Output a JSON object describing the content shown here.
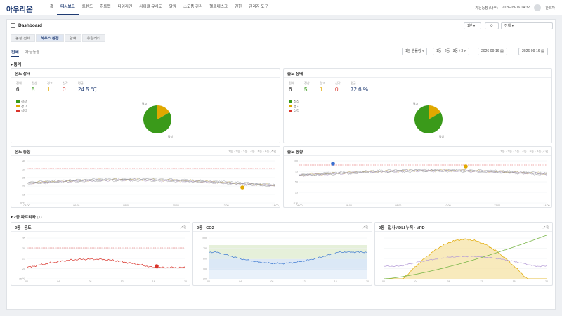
{
  "app": {
    "logo": "아우리온",
    "logo_sub": "| ·"
  },
  "nav": [
    "홈",
    "대시보드",
    "트렌드",
    "히트맵",
    "타임라인",
    "사이클 유사도",
    "알람",
    "소모품 관리",
    "헬프데스크",
    "권한",
    "관리자 도구"
  ],
  "nav_active": 1,
  "top_right": {
    "farm": "가능농장 (나주)",
    "datetime": "2026-09-16 14:32",
    "user": "관리자"
  },
  "dashboard": {
    "title": "Dashboard",
    "interval": "1분",
    "refresh_icon": "refresh-icon",
    "scope": "전체"
  },
  "subtabs": [
    "농장 전체",
    "하우스 환경",
    "양액",
    "유틸리티"
  ],
  "subtab_active": 1,
  "viewtabs": [
    "전체",
    "가능농장"
  ],
  "filters": {
    "sampling": "1분 샘플링",
    "houses": "1동 · 2동 · 3동 +3",
    "start": "2026-09-16",
    "end": "2026-09-16"
  },
  "stats_section": {
    "title": "▾ 통계"
  },
  "temp_status": {
    "title": "온도 상태",
    "kpis": [
      {
        "label": "전체",
        "value": "6",
        "color": "#222222"
      },
      {
        "label": "정상",
        "value": "5",
        "color": "#3a9a1a"
      },
      {
        "label": "경고",
        "value": "1",
        "color": "#e0a800"
      },
      {
        "label": "심각",
        "value": "0",
        "color": "#d9342b"
      }
    ],
    "avg": {
      "label": "평균",
      "value": "24.5 ℃",
      "color": "#1f3b73"
    },
    "pie_labels": {
      "warn": "경고",
      "normal": "정상"
    },
    "pie": {
      "normal": 5,
      "warn": 1,
      "crit": 0
    }
  },
  "hum_status": {
    "title": "습도 상태",
    "kpis": [
      {
        "label": "전체",
        "value": "6",
        "color": "#222222"
      },
      {
        "label": "정상",
        "value": "5",
        "color": "#3a9a1a"
      },
      {
        "label": "경고",
        "value": "1",
        "color": "#e0a800"
      },
      {
        "label": "심각",
        "value": "0",
        "color": "#d9342b"
      }
    ],
    "avg": {
      "label": "평균",
      "value": "72.6 %",
      "color": "#1f3b73"
    },
    "pie_labels": {
      "warn": "경고",
      "normal": "정상"
    },
    "pie": {
      "normal": 5,
      "warn": 1,
      "crit": 0
    }
  },
  "legend": [
    {
      "label": "정상",
      "color": "#3a9a1a"
    },
    {
      "label": "경고",
      "color": "#e0a800"
    },
    {
      "label": "심각",
      "color": "#d9342b"
    }
  ],
  "trend_tools": "1동 · 2동 · 3동 · 4동 · 5동 · 6동 ⤢ ⎘",
  "card_tools": "⤢ ⎘",
  "temp_trend": {
    "title": "온도 동향",
    "y_ticks": [
      "40",
      "30",
      "25",
      "20",
      "15",
      "0 ℃"
    ],
    "x_ticks": [
      "04:00",
      "06:00",
      "08:00",
      "10:00",
      "12:00",
      "14:00"
    ]
  },
  "hum_trend": {
    "title": "습도 동향",
    "y_ticks": [
      "100",
      "75",
      "50",
      "25",
      "0 %"
    ],
    "x_ticks": [
      "04:00",
      "06:00",
      "08:00",
      "10:00",
      "12:00",
      "14:00"
    ]
  },
  "house2_section": {
    "title": "▾ 2동 파프리카",
    "count": "(1)"
  },
  "h2_temp": {
    "title": "2동 · 온도",
    "y_ticks": [
      "35",
      "30",
      "25",
      "20",
      "15 ℃"
    ],
    "x_ticks": [
      "00",
      "04",
      "08",
      "12",
      "16",
      "20"
    ]
  },
  "h2_co2": {
    "title": "2동 · CO2",
    "y_ticks": [
      "1000",
      "750",
      "600",
      "400",
      "200"
    ],
    "x_ticks": [
      "00",
      "04",
      "08",
      "12",
      "16",
      "20"
    ]
  },
  "h2_light": {
    "title": "2동 · 일사 / DLI 누적 · VPD",
    "x_ticks": [
      "00",
      "04",
      "08",
      "12",
      "16",
      "20"
    ]
  },
  "colors": {
    "accent": "#1f3b73",
    "normal": "#3a9a1a",
    "warn": "#e0a800",
    "crit": "#d9342b",
    "threshold": "#e05252"
  }
}
